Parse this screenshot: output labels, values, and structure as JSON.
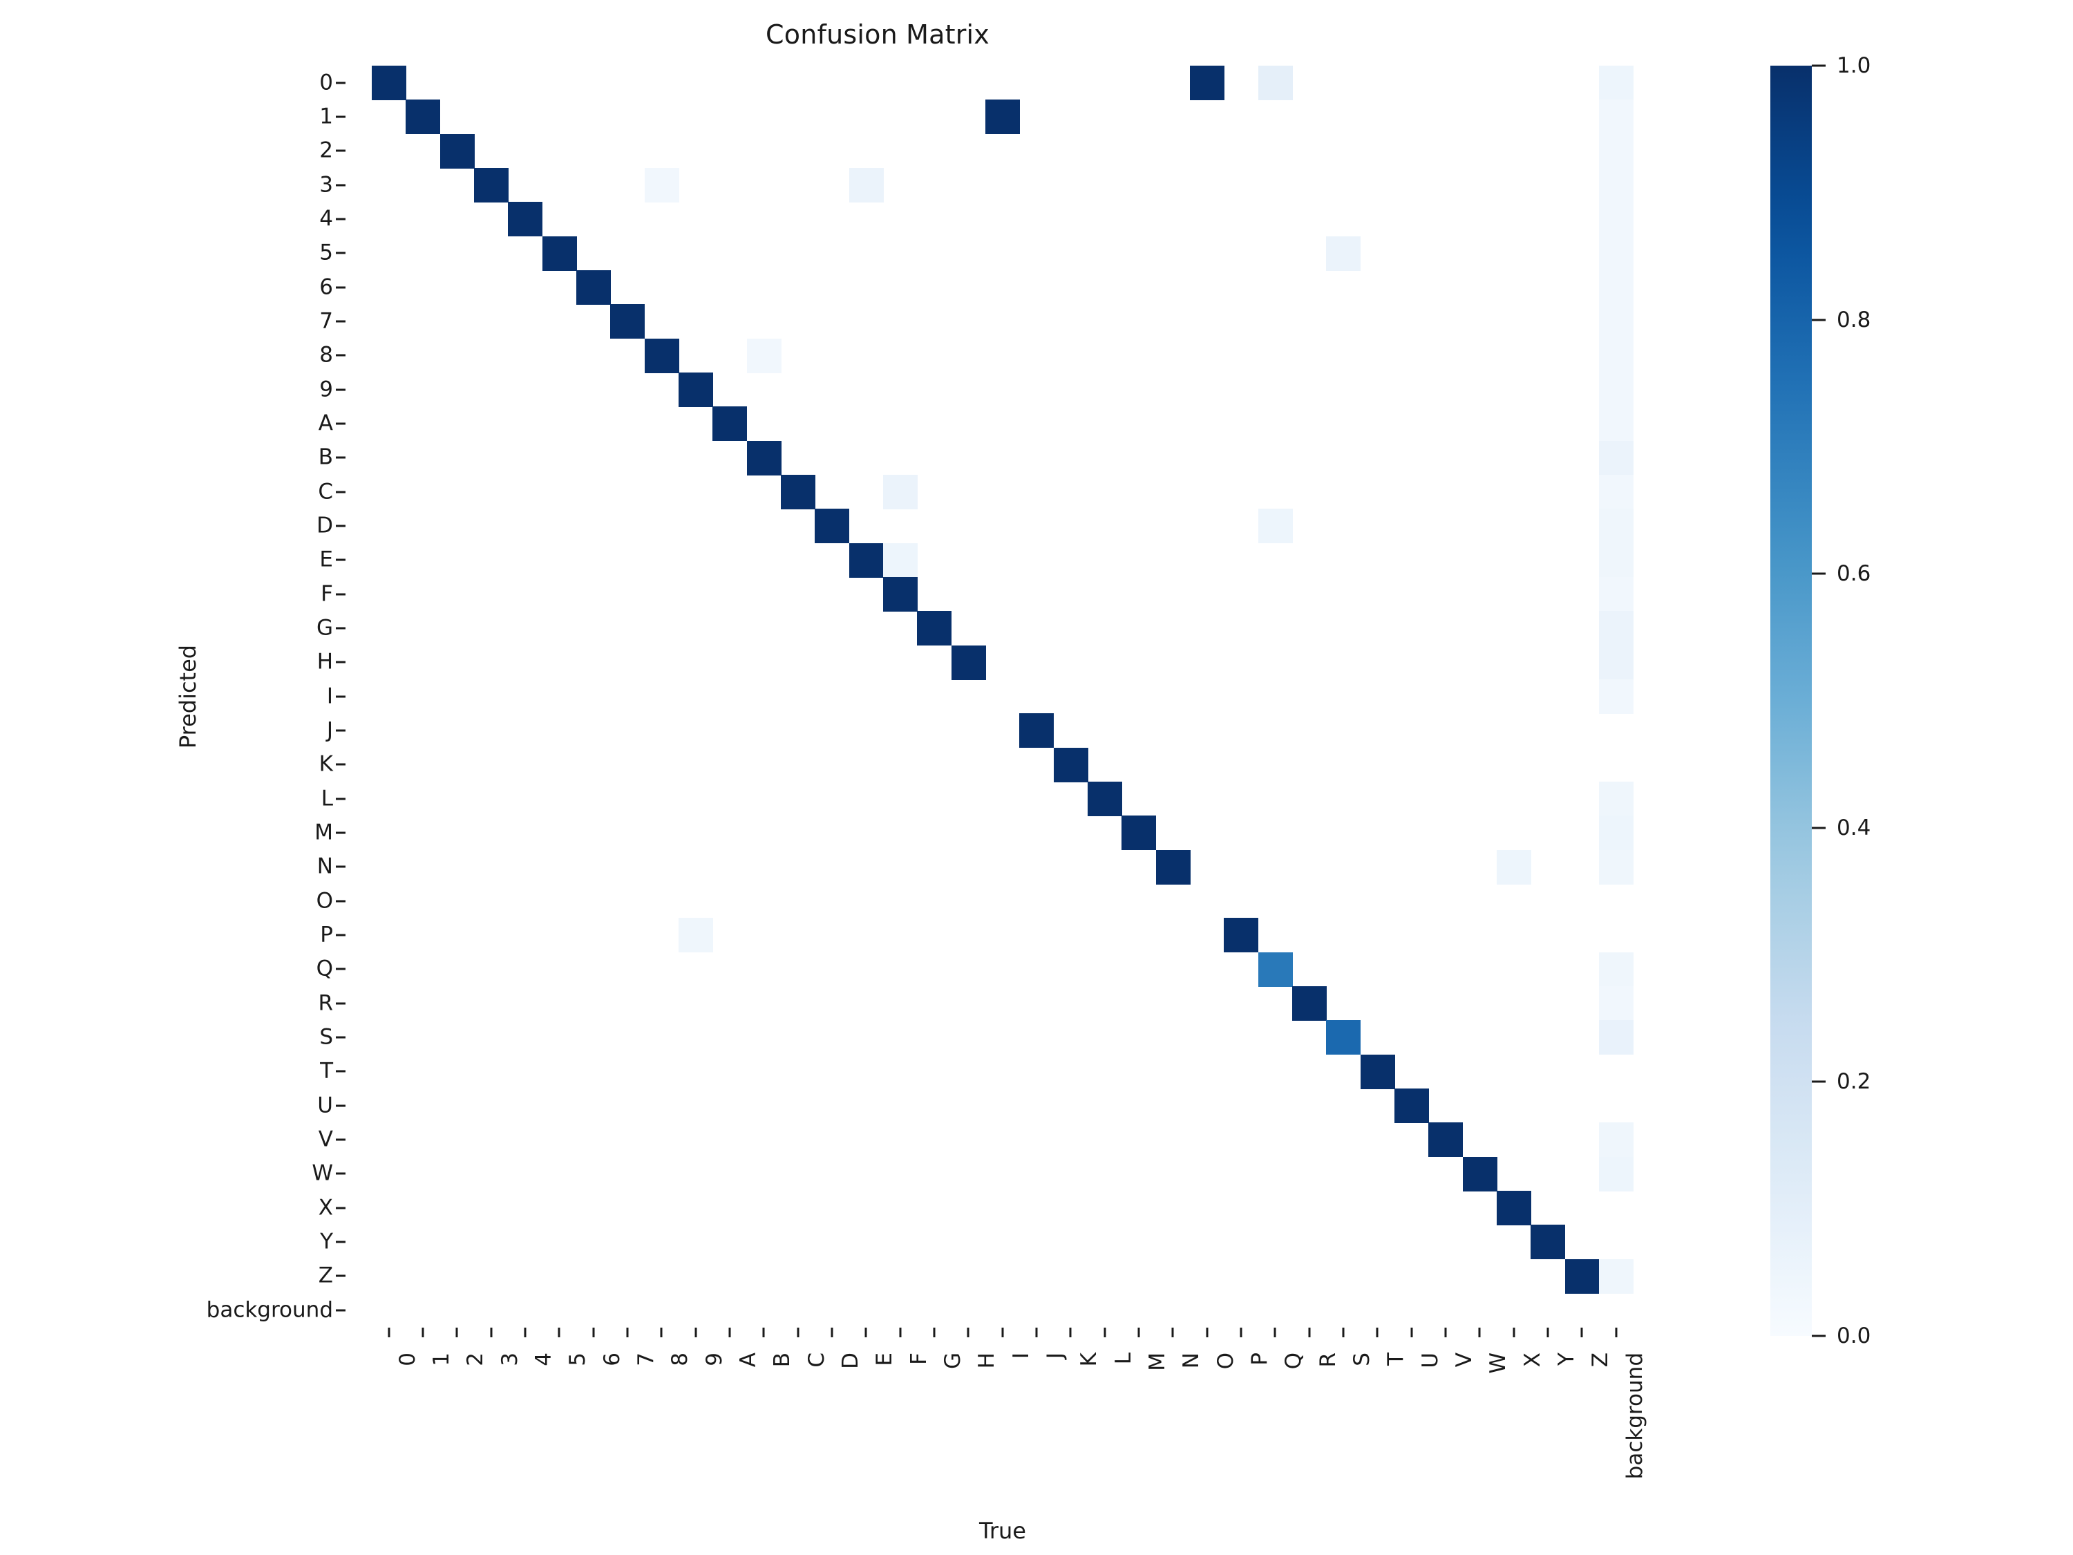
{
  "figure": {
    "title": "Confusion Matrix",
    "xlabel": "True",
    "ylabel": "Predicted"
  },
  "colorbar": {
    "ticks": [
      "0.0",
      "0.2",
      "0.4",
      "0.6",
      "0.8",
      "1.0"
    ],
    "tick_values": [
      0.0,
      0.2,
      0.4,
      0.6,
      0.8,
      1.0
    ],
    "vmin": 0.0,
    "vmax": 1.0,
    "colormap": "Blues",
    "low_color": "#f7fbff",
    "high_color": "#08306b"
  },
  "chart_data": {
    "type": "heatmap",
    "title": "Confusion Matrix",
    "xlabel": "True",
    "ylabel": "Predicted",
    "grid": false,
    "legend_position": "right-colorbar",
    "cmap": "Blues",
    "zlim": [
      0.0,
      1.0
    ],
    "x_categories": [
      "0",
      "1",
      "2",
      "3",
      "4",
      "5",
      "6",
      "7",
      "8",
      "9",
      "A",
      "B",
      "C",
      "D",
      "E",
      "F",
      "G",
      "H",
      "I",
      "J",
      "K",
      "L",
      "M",
      "N",
      "O",
      "P",
      "Q",
      "R",
      "S",
      "T",
      "U",
      "V",
      "W",
      "X",
      "Y",
      "Z",
      "background"
    ],
    "y_categories": [
      "0",
      "1",
      "2",
      "3",
      "4",
      "5",
      "6",
      "7",
      "8",
      "9",
      "A",
      "B",
      "C",
      "D",
      "E",
      "F",
      "G",
      "H",
      "I",
      "J",
      "K",
      "L",
      "M",
      "N",
      "O",
      "P",
      "Q",
      "R",
      "S",
      "T",
      "U",
      "V",
      "W",
      "X",
      "Y",
      "Z",
      "background"
    ],
    "cells": [
      {
        "row": 0,
        "col": 0,
        "value": 1.0
      },
      {
        "row": 0,
        "col": 24,
        "value": 1.0
      },
      {
        "row": 0,
        "col": 26,
        "value": 0.09
      },
      {
        "row": 0,
        "col": 36,
        "value": 0.05
      },
      {
        "row": 1,
        "col": 1,
        "value": 1.0
      },
      {
        "row": 1,
        "col": 18,
        "value": 1.0
      },
      {
        "row": 1,
        "col": 36,
        "value": 0.03
      },
      {
        "row": 2,
        "col": 2,
        "value": 1.0
      },
      {
        "row": 2,
        "col": 36,
        "value": 0.03
      },
      {
        "row": 3,
        "col": 3,
        "value": 1.0
      },
      {
        "row": 3,
        "col": 8,
        "value": 0.03
      },
      {
        "row": 3,
        "col": 14,
        "value": 0.06
      },
      {
        "row": 3,
        "col": 36,
        "value": 0.03
      },
      {
        "row": 4,
        "col": 4,
        "value": 1.0
      },
      {
        "row": 4,
        "col": 36,
        "value": 0.03
      },
      {
        "row": 5,
        "col": 5,
        "value": 1.0
      },
      {
        "row": 5,
        "col": 28,
        "value": 0.06
      },
      {
        "row": 5,
        "col": 36,
        "value": 0.03
      },
      {
        "row": 6,
        "col": 6,
        "value": 1.0
      },
      {
        "row": 6,
        "col": 36,
        "value": 0.03
      },
      {
        "row": 7,
        "col": 7,
        "value": 1.0
      },
      {
        "row": 7,
        "col": 36,
        "value": 0.03
      },
      {
        "row": 8,
        "col": 8,
        "value": 1.0
      },
      {
        "row": 8,
        "col": 11,
        "value": 0.03
      },
      {
        "row": 8,
        "col": 36,
        "value": 0.03
      },
      {
        "row": 9,
        "col": 9,
        "value": 1.0
      },
      {
        "row": 9,
        "col": 36,
        "value": 0.03
      },
      {
        "row": 10,
        "col": 10,
        "value": 1.0
      },
      {
        "row": 10,
        "col": 36,
        "value": 0.03
      },
      {
        "row": 11,
        "col": 11,
        "value": 1.0
      },
      {
        "row": 11,
        "col": 36,
        "value": 0.06
      },
      {
        "row": 12,
        "col": 12,
        "value": 1.0
      },
      {
        "row": 12,
        "col": 15,
        "value": 0.06
      },
      {
        "row": 12,
        "col": 36,
        "value": 0.03
      },
      {
        "row": 13,
        "col": 13,
        "value": 1.0
      },
      {
        "row": 13,
        "col": 26,
        "value": 0.05
      },
      {
        "row": 13,
        "col": 36,
        "value": 0.04
      },
      {
        "row": 14,
        "col": 14,
        "value": 1.0
      },
      {
        "row": 14,
        "col": 15,
        "value": 0.05
      },
      {
        "row": 14,
        "col": 36,
        "value": 0.04
      },
      {
        "row": 15,
        "col": 15,
        "value": 1.0
      },
      {
        "row": 15,
        "col": 36,
        "value": 0.03
      },
      {
        "row": 16,
        "col": 16,
        "value": 1.0
      },
      {
        "row": 16,
        "col": 36,
        "value": 0.06
      },
      {
        "row": 17,
        "col": 17,
        "value": 1.0
      },
      {
        "row": 17,
        "col": 36,
        "value": 0.06
      },
      {
        "row": 18,
        "col": 36,
        "value": 0.03
      },
      {
        "row": 19,
        "col": 19,
        "value": 1.0
      },
      {
        "row": 20,
        "col": 20,
        "value": 1.0
      },
      {
        "row": 21,
        "col": 21,
        "value": 1.0
      },
      {
        "row": 21,
        "col": 36,
        "value": 0.04
      },
      {
        "row": 22,
        "col": 22,
        "value": 1.0
      },
      {
        "row": 22,
        "col": 36,
        "value": 0.05
      },
      {
        "row": 23,
        "col": 23,
        "value": 1.0
      },
      {
        "row": 23,
        "col": 33,
        "value": 0.05
      },
      {
        "row": 23,
        "col": 36,
        "value": 0.04
      },
      {
        "row": 25,
        "col": 25,
        "value": 1.0
      },
      {
        "row": 25,
        "col": 9,
        "value": 0.04
      },
      {
        "row": 26,
        "col": 26,
        "value": 0.72
      },
      {
        "row": 26,
        "col": 36,
        "value": 0.04
      },
      {
        "row": 27,
        "col": 27,
        "value": 1.0
      },
      {
        "row": 27,
        "col": 36,
        "value": 0.03
      },
      {
        "row": 28,
        "col": 28,
        "value": 0.78
      },
      {
        "row": 28,
        "col": 36,
        "value": 0.07
      },
      {
        "row": 29,
        "col": 29,
        "value": 1.0
      },
      {
        "row": 30,
        "col": 30,
        "value": 1.0
      },
      {
        "row": 31,
        "col": 31,
        "value": 1.0
      },
      {
        "row": 31,
        "col": 36,
        "value": 0.04
      },
      {
        "row": 32,
        "col": 32,
        "value": 1.0
      },
      {
        "row": 32,
        "col": 36,
        "value": 0.05
      },
      {
        "row": 33,
        "col": 33,
        "value": 1.0
      },
      {
        "row": 34,
        "col": 34,
        "value": 1.0
      },
      {
        "row": 35,
        "col": 35,
        "value": 1.0
      },
      {
        "row": 35,
        "col": 36,
        "value": 0.04
      }
    ]
  }
}
